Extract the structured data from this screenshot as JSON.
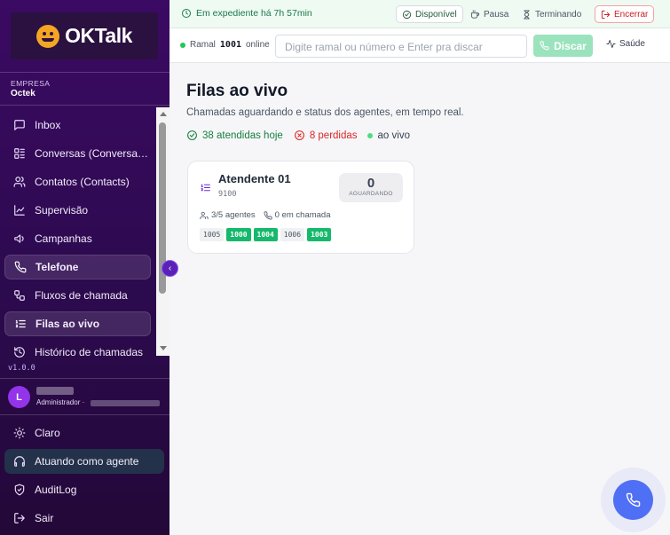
{
  "brand": {
    "name": "OKTalk"
  },
  "company": {
    "label": "EMPRESA",
    "name": "Octek"
  },
  "nav": [
    {
      "label": "Inbox",
      "icon": "message-square-icon",
      "active": false
    },
    {
      "label": "Conversas (Conversations)",
      "icon": "layout-list-icon",
      "active": false
    },
    {
      "label": "Contatos (Contacts)",
      "icon": "users-icon",
      "active": false
    },
    {
      "label": "Supervisão",
      "icon": "line-chart-icon",
      "active": false
    },
    {
      "label": "Campanhas",
      "icon": "megaphone-icon",
      "active": false
    },
    {
      "label": "Telefone",
      "icon": "phone-icon",
      "active": true
    },
    {
      "label": "Fluxos de chamada",
      "icon": "workflow-icon",
      "active": false
    },
    {
      "label": "Filas ao vivo",
      "icon": "list-ordered-icon",
      "active": true
    },
    {
      "label": "Histórico de chamadas",
      "icon": "history-icon",
      "active": false
    }
  ],
  "version": "v1.0.0",
  "user": {
    "initial": "L",
    "role": "Administrador ·"
  },
  "bottom_nav": [
    {
      "label": "Claro",
      "icon": "sun-icon"
    },
    {
      "label": "Atuando como agente",
      "icon": "headphones-icon"
    },
    {
      "label": "AuditLog",
      "icon": "shield-icon"
    },
    {
      "label": "Sair",
      "icon": "log-out-icon"
    }
  ],
  "topbar": {
    "expediente": "Em expediente há 7h 57min",
    "status_disponivel": "Disponível",
    "status_pausa": "Pausa",
    "status_terminando": "Terminando",
    "encerrar": "Encerrar"
  },
  "dialbar": {
    "ramal_prefix": "Ramal",
    "ramal_number": "1001",
    "ramal_suffix": "online",
    "input_placeholder": "Digite ramal ou número e Enter pra discar",
    "discar": "Discar",
    "saude": "Saúde"
  },
  "main": {
    "title": "Filas ao vivo",
    "subtitle": "Chamadas aguardando e status dos agentes, em tempo real.",
    "stats": {
      "answered": "38 atendidas hoje",
      "lost": "8 perdidas",
      "live": "ao vivo"
    }
  },
  "queue": {
    "name": "Atendente 01",
    "number": "9100",
    "waiting_count": "0",
    "waiting_label": "AGUARDANDO",
    "agents": "3/5 agentes",
    "in_call": "0 em chamada",
    "extensions": [
      {
        "ext": "1005",
        "busy": false
      },
      {
        "ext": "1000",
        "busy": true
      },
      {
        "ext": "1004",
        "busy": true
      },
      {
        "ext": "1006",
        "busy": false
      },
      {
        "ext": "1003",
        "busy": true
      }
    ]
  },
  "colors": {
    "sidebar_bg": "#2c0a4e",
    "accent_green": "#16b96b",
    "lost_red": "#dc2626",
    "fab_blue": "#4f6ff5",
    "logo_orange": "#f5a524"
  }
}
